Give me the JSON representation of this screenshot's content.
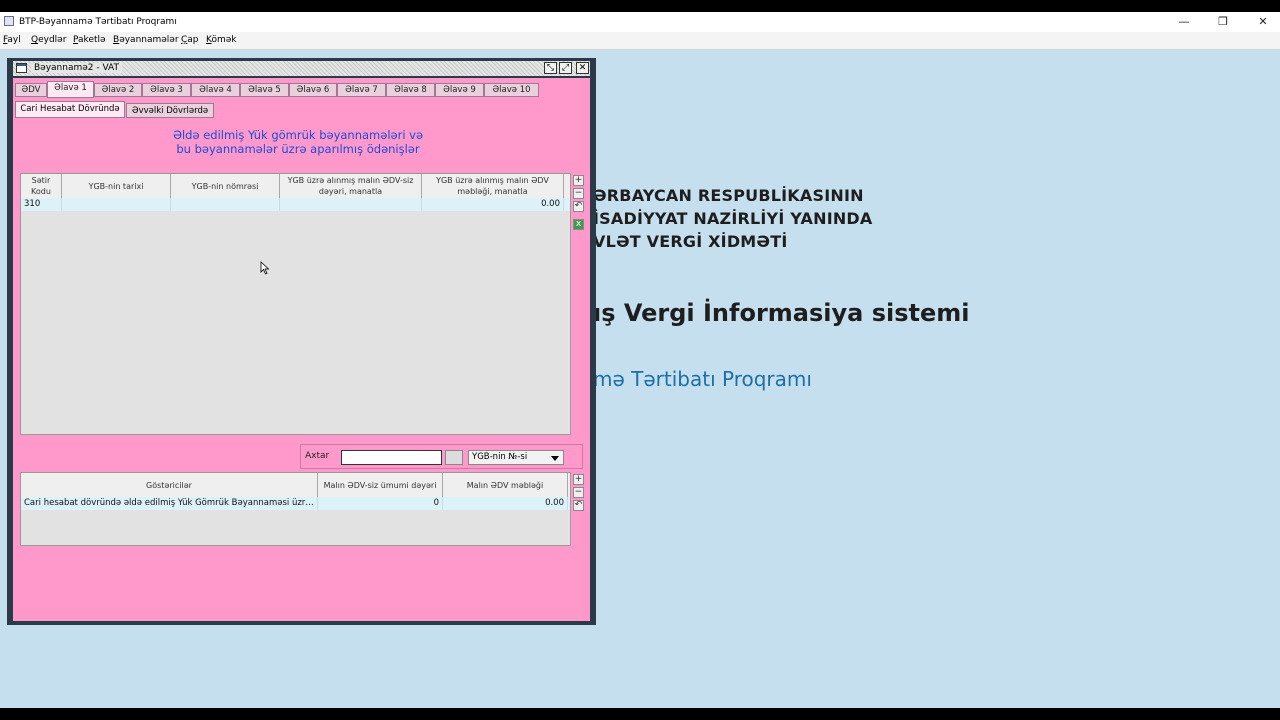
{
  "window": {
    "title": "BTP-Bəyannamə Tərtibatı Proqramı",
    "minimize": "—",
    "restore": "❐",
    "close": "✕"
  },
  "menu": [
    "Fayl",
    "Qeydlər",
    "Paketlə",
    "Bəyannamələr",
    "Çap",
    "Kömək"
  ],
  "background": {
    "line1": "ƏRBAYCAN RESPUBLİKASININ",
    "line2": "İSADİYYAT NAZİRLİYİ YANINDA",
    "line3": "VLƏT VERGİ XİDMƏTİ",
    "system": "ış Vergi İnformasiya sistemi",
    "program": "mə Tərtibatı Proqramı"
  },
  "inner_window": {
    "title": "Bəyannamə2 - VAT",
    "tabs": [
      "ƏDV",
      "Əlavə 1",
      "Əlavə 2",
      "Əlavə 3",
      "Əlavə 4",
      "Əlavə 5",
      "Əlavə 6",
      "Əlavə 7",
      "Əlavə 8",
      "Əlavə 9",
      "Əlavə 10"
    ],
    "active_tab": "Əlavə 1",
    "subtabs": [
      "Cari Hesabat Dövründə",
      "Əvvəlki Dövrlərdə"
    ],
    "active_subtab": "Cari Hesabat Dövründə",
    "heading": {
      "line1": "Əldə edilmiş Yük gömrük bəyannamələri və",
      "line2": "bu bəyannamələr üzrə aparılmış ödənişlər"
    },
    "table1": {
      "columns": [
        "Sətir Kodu",
        "YGB-nin tarixi",
        "YGB-nin nömrəsi",
        "YGB üzrə alınmış malın ƏDV-siz dəyəri, manatla",
        "YGB üzrə alınmış malın ƏDV məbləği, manatla"
      ],
      "rows": [
        [
          "310",
          "",
          "",
          "",
          "0.00"
        ]
      ]
    },
    "search": {
      "label": "Axtar",
      "value": "",
      "select_value": "YGB-nin №-si"
    },
    "table2": {
      "columns": [
        "Göstəricilər",
        "Malın ƏDV-siz ümumi dəyəri",
        "Malın ƏDV məbləği"
      ],
      "rows": [
        [
          "Cari hesabat dövründə əldə edilmiş Yük Gömrük Bəyannaməsi üzrə alınmış",
          "0",
          "0.00"
        ]
      ]
    }
  }
}
